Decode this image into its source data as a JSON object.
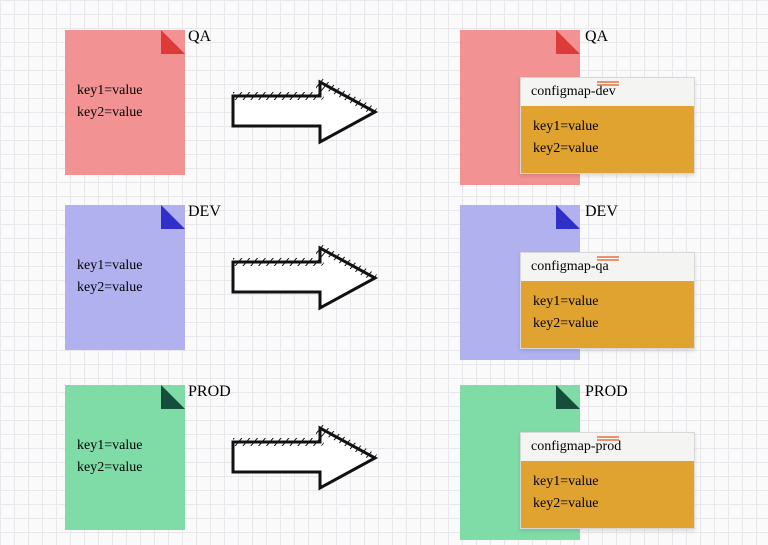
{
  "envs": [
    {
      "id": "qa",
      "label": "QA",
      "file": {
        "line1": "key1=value",
        "line2": "key2=value"
      },
      "configmap": {
        "name": "configmap-dev",
        "line1": "key1=value",
        "line2": "key2=value"
      }
    },
    {
      "id": "dev",
      "label": "DEV",
      "file": {
        "line1": "key1=value",
        "line2": "key2=value"
      },
      "configmap": {
        "name": "configmap-qa",
        "line1": "key1=value",
        "line2": "key2=value"
      }
    },
    {
      "id": "prod",
      "label": "PROD",
      "file": {
        "line1": "key1=value",
        "line2": "key2=value"
      },
      "configmap": {
        "name": "configmap-prod",
        "line1": "key1=value",
        "line2": "key2=value"
      }
    }
  ],
  "colors": {
    "qa": {
      "bg": "#f29292",
      "corner": "#de3a3a"
    },
    "dev": {
      "bg": "#b1b1ef",
      "corner": "#3030c8"
    },
    "prod": {
      "bg": "#7fdca7",
      "corner": "#154f3c"
    },
    "configmap_body": "#e0a330"
  }
}
